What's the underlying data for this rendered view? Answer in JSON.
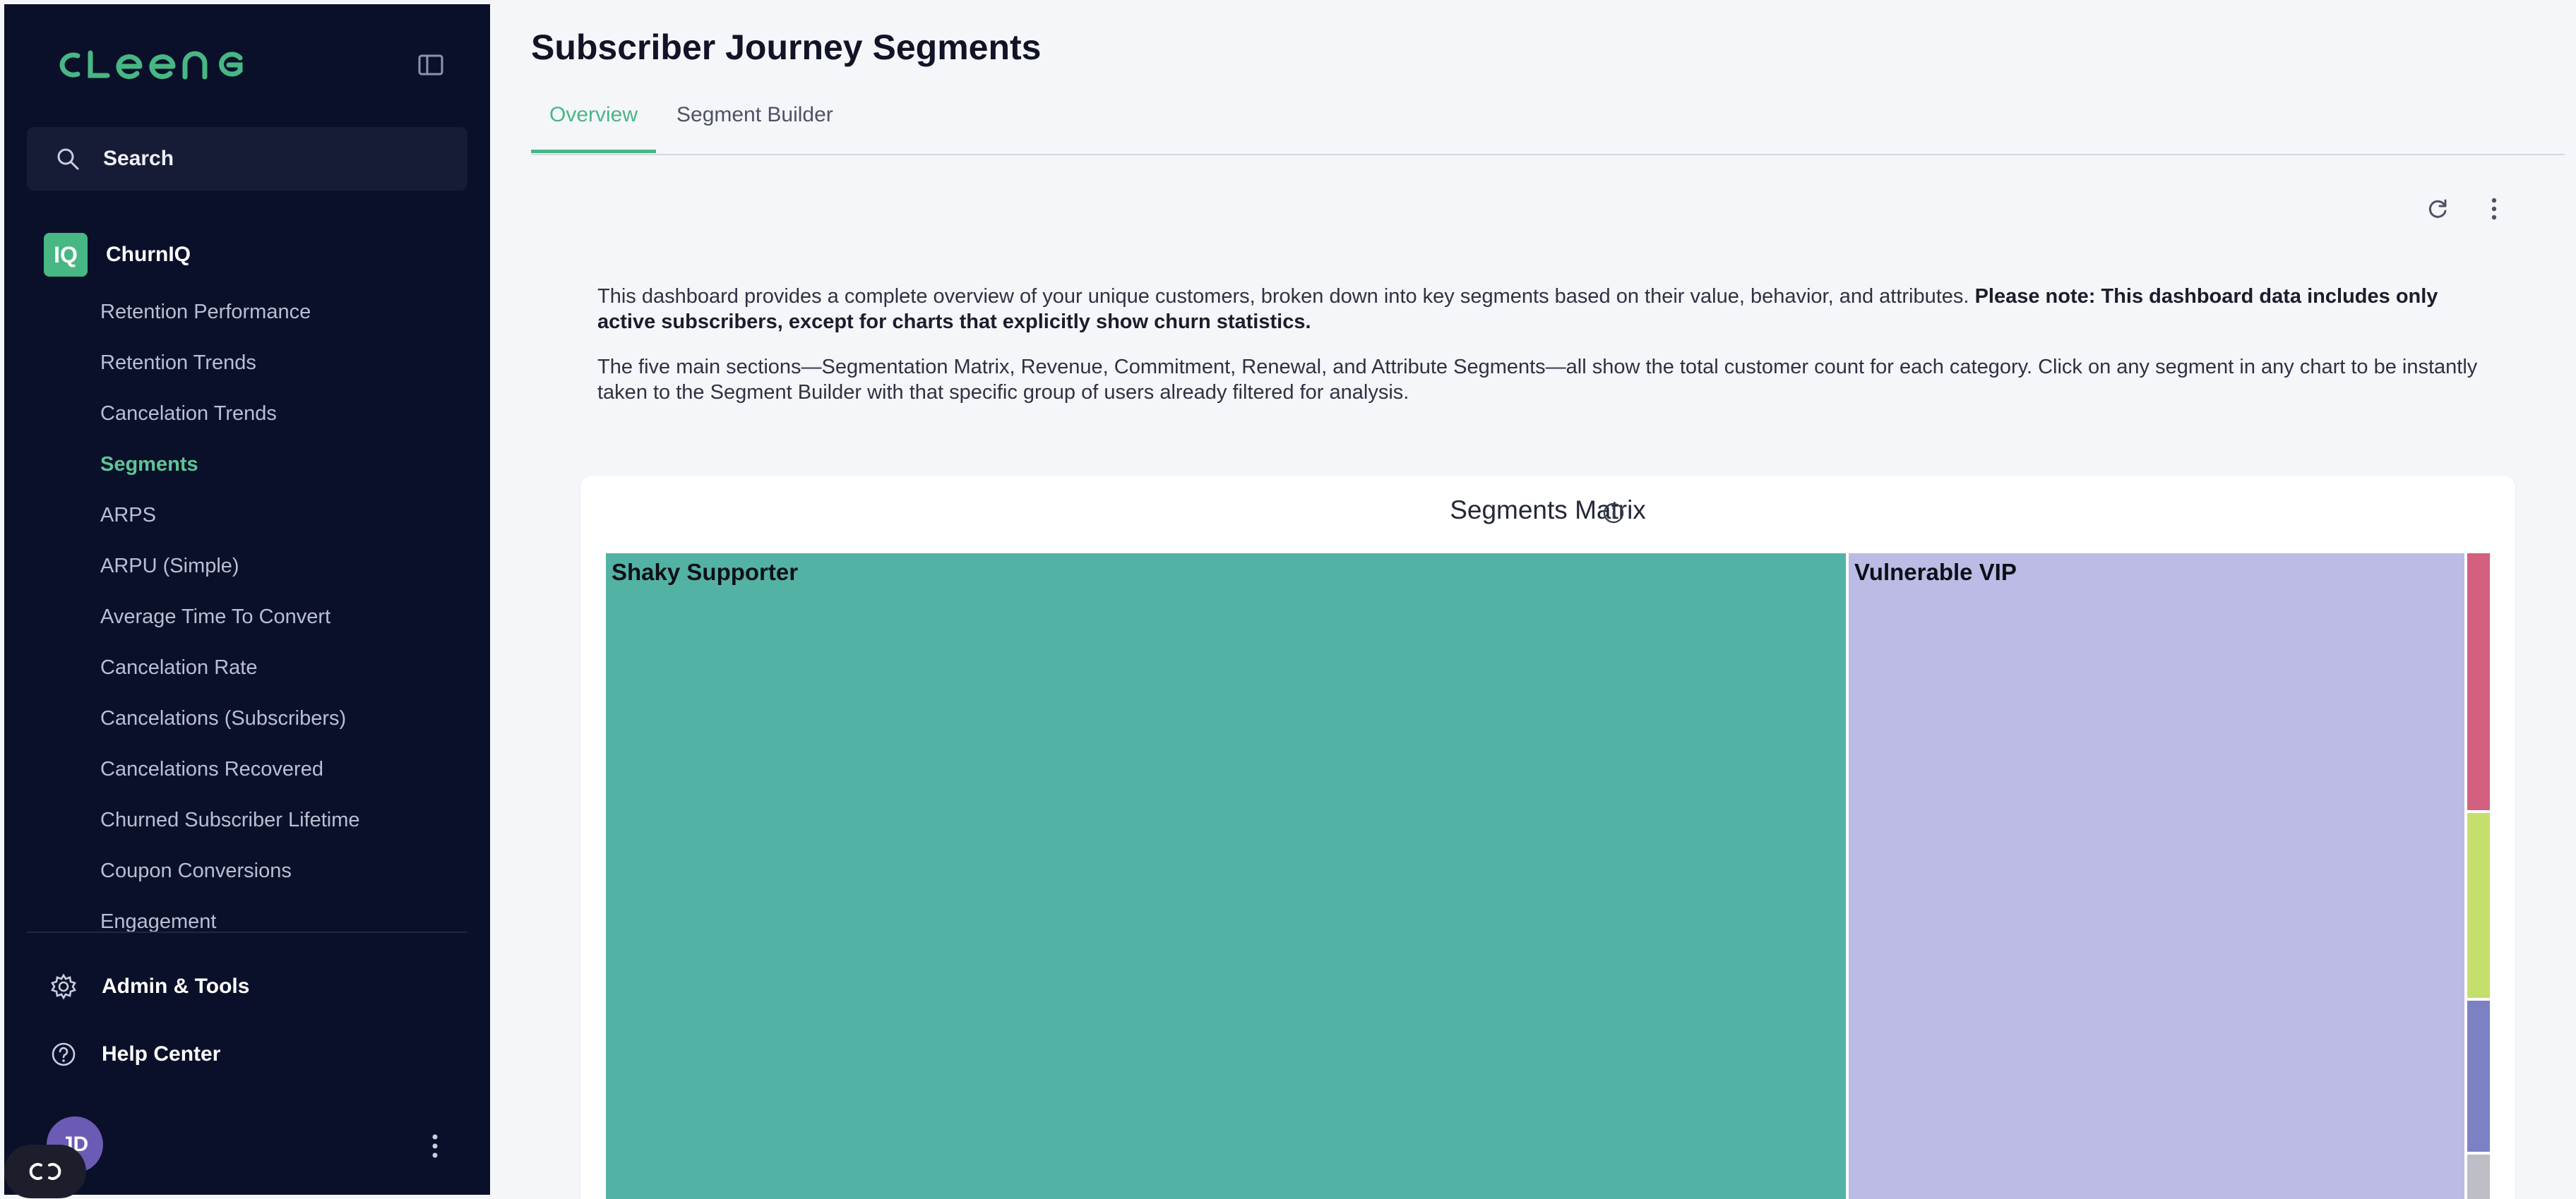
{
  "sidebar": {
    "logo_text": "CLEENG",
    "collapse_icon": "sidebar-toggle-icon",
    "search_label": "Search",
    "product": {
      "badge": "IQ",
      "name": "ChurnIQ"
    },
    "nav_items": [
      {
        "label": "Retention Performance"
      },
      {
        "label": "Retention Trends"
      },
      {
        "label": "Cancelation Trends"
      },
      {
        "label": "Segments",
        "active": true
      },
      {
        "label": "ARPS"
      },
      {
        "label": "ARPU (Simple)"
      },
      {
        "label": "Average Time To Convert"
      },
      {
        "label": "Cancelation Rate"
      },
      {
        "label": "Cancelations (Subscribers)"
      },
      {
        "label": "Cancelations Recovered"
      },
      {
        "label": "Churned Subscriber Lifetime"
      },
      {
        "label": "Coupon Conversions"
      },
      {
        "label": "Engagement"
      }
    ],
    "admin_label": "Admin & Tools",
    "help_label": "Help Center",
    "avatar_initials": "JD"
  },
  "main": {
    "title": "Subscriber Journey Segments",
    "tabs": [
      {
        "label": "Overview",
        "active": true
      },
      {
        "label": "Segment Builder"
      }
    ],
    "intro_p1": "This dashboard provides a complete overview of your unique customers, broken down into key segments based on their value, behavior, and attributes. ",
    "intro_p1_bold": "Please note: This dashboard data includes only active subscribers, except for charts that explicitly show churn statistics.",
    "intro_p2": "The five main sections—Segmentation Matrix, Revenue, Commitment, Renewal, and Attribute Segments—all show the total customer count for each category. Click on any segment in any chart to be instantly taken to the Segment Builder with that specific group of users already filtered for analysis."
  },
  "chart_data": {
    "type": "treemap",
    "title": "Segments Matrix",
    "segments": [
      {
        "label": "Shaky Supporter",
        "color": "#52b3a5"
      },
      {
        "label": "Vulnerable VIP",
        "color": "#bcbbe5"
      },
      {
        "label": "",
        "color": "#d2607e"
      },
      {
        "label": "",
        "color": "#c4df6b"
      },
      {
        "label": "",
        "color": "#7c81c4"
      },
      {
        "label": "",
        "color": "#bcbdc5"
      }
    ]
  },
  "colors": {
    "sidebar_bg": "#0a1029",
    "accent": "#47b784",
    "page_bg": "#f5f6fa"
  }
}
